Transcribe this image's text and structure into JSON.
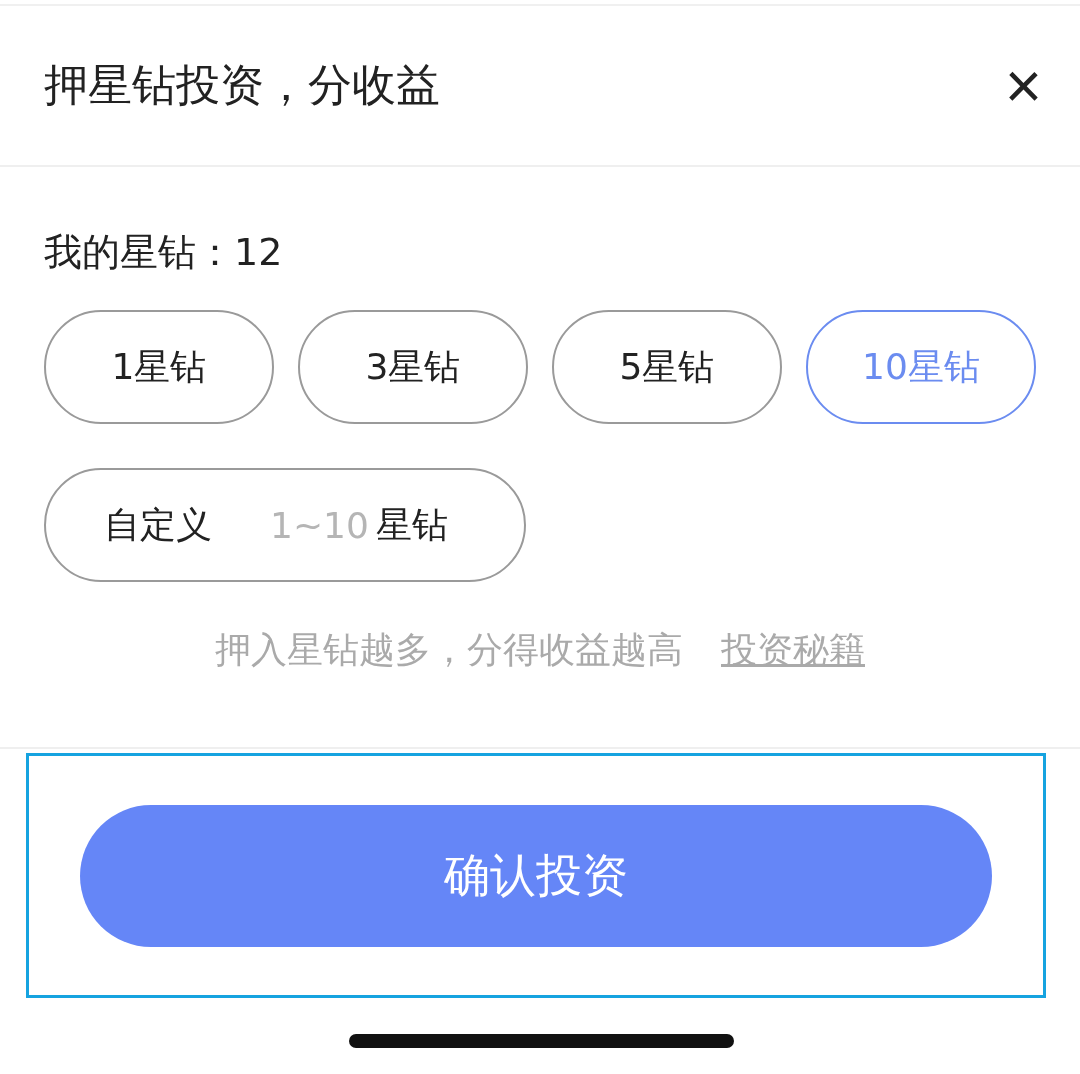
{
  "header": {
    "title": "押星钻投资，分收益",
    "close": "×"
  },
  "balance": {
    "label": "我的星钻：12"
  },
  "options": [
    {
      "label": "1星钻",
      "selected": false
    },
    {
      "label": "3星钻",
      "selected": false
    },
    {
      "label": "5星钻",
      "selected": false
    },
    {
      "label": "10星钻",
      "selected": true
    }
  ],
  "custom": {
    "label": "自定义",
    "placeholder": "1~10",
    "unit": "星钻"
  },
  "hint": {
    "text": "押入星钻越多，分得收益越高",
    "link": "投资秘籍"
  },
  "confirm": {
    "label": "确认投资",
    "highlighted": true
  }
}
